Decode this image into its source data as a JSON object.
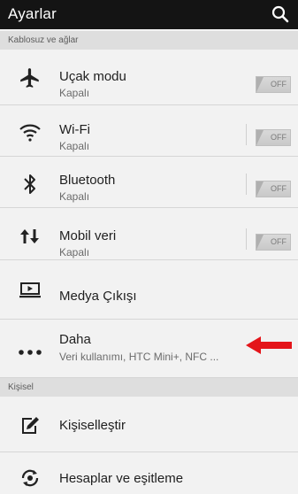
{
  "topbar": {
    "title": "Ayarlar",
    "search_icon": "search-icon"
  },
  "sections": {
    "wireless": "Kablosuz ve ağlar",
    "personal": "Kişisel"
  },
  "items": {
    "airplane": {
      "label": "Uçak modu",
      "sub": "Kapalı",
      "toggle": "OFF",
      "icon": "airplane-icon"
    },
    "wifi": {
      "label": "Wi-Fi",
      "sub": "Kapalı",
      "toggle": "OFF",
      "icon": "wifi-icon"
    },
    "bluetooth": {
      "label": "Bluetooth",
      "sub": "Kapalı",
      "toggle": "OFF",
      "icon": "bluetooth-icon"
    },
    "mobile": {
      "label": "Mobil veri",
      "sub": "Kapalı",
      "toggle": "OFF",
      "icon": "mobile-data-icon"
    },
    "media": {
      "label": "Medya Çıkışı",
      "icon": "media-output-icon"
    },
    "more": {
      "label": "Daha",
      "sub": "Veri kullanımı, HTC Mini+, NFC ...",
      "icon": "more-dots-icon"
    },
    "personalize": {
      "label": "Kişiselleştir",
      "icon": "personalize-icon"
    },
    "accounts": {
      "label": "Hesaplar ve eşitleme",
      "icon": "sync-icon"
    }
  },
  "colors": {
    "annotation_arrow": "#e4151a",
    "topbar": "#141414"
  }
}
